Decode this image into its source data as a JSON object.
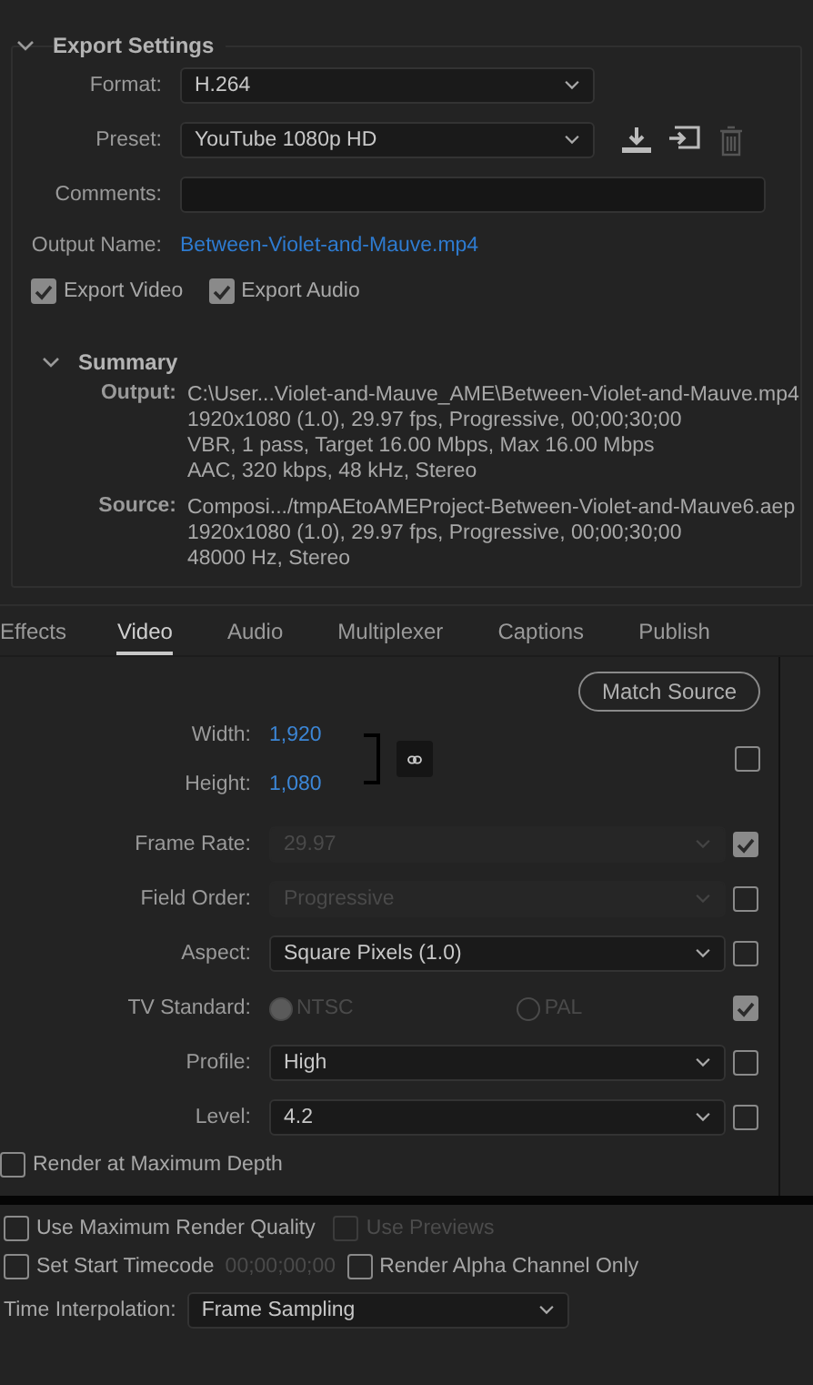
{
  "export_settings": {
    "title": "Export Settings",
    "expanded": true,
    "format": {
      "label": "Format:",
      "value": "H.264"
    },
    "preset": {
      "label": "Preset:",
      "value": "YouTube 1080p HD"
    },
    "comments": {
      "label": "Comments:"
    },
    "output_name": {
      "label": "Output Name:",
      "value": "Between-Violet-and-Mauve.mp4"
    },
    "export_video": {
      "label": "Export Video",
      "checked": true
    },
    "export_audio": {
      "label": "Export Audio",
      "checked": true
    },
    "summary": {
      "title": "Summary",
      "expanded": true,
      "output": {
        "label": "Output:",
        "lines": [
          "C:\\User...Violet-and-Mauve_AME\\Between-Violet-and-Mauve.mp4",
          "1920x1080 (1.0), 29.97 fps, Progressive, 00;00;30;00",
          "VBR, 1 pass, Target 16.00 Mbps, Max 16.00 Mbps",
          "AAC, 320 kbps, 48 kHz, Stereo"
        ]
      },
      "source": {
        "label": "Source:",
        "lines": [
          "Composi.../tmpAEtoAMEProject-Between-Violet-and-Mauve6.aep",
          "1920x1080 (1.0), 29.97 fps, Progressive, 00;00;30;00",
          "48000 Hz, Stereo"
        ]
      }
    }
  },
  "tabs": [
    {
      "label": "Effects",
      "selected": false
    },
    {
      "label": "Video",
      "selected": true
    },
    {
      "label": "Audio",
      "selected": false
    },
    {
      "label": "Multiplexer",
      "selected": false
    },
    {
      "label": "Captions",
      "selected": false
    },
    {
      "label": "Publish",
      "selected": false
    }
  ],
  "video": {
    "match_source": "Match Source",
    "width": {
      "label": "Width:",
      "value": "1,920"
    },
    "height": {
      "label": "Height:",
      "value": "1,080"
    },
    "size_checked": false,
    "rows": [
      {
        "kind": "select",
        "label": "Frame Rate:",
        "value": "29.97",
        "disabled": true,
        "checked": true
      },
      {
        "kind": "select",
        "label": "Field Order:",
        "value": "Progressive",
        "disabled": true,
        "checked": false
      },
      {
        "kind": "select",
        "label": "Aspect:",
        "value": "Square Pixels (1.0)",
        "disabled": false,
        "checked": false
      },
      {
        "kind": "radio",
        "label": "TV Standard:",
        "options": [
          {
            "label": "NTSC",
            "selected": true
          },
          {
            "label": "PAL",
            "selected": false
          }
        ],
        "disabled": true,
        "checked": true
      },
      {
        "kind": "select",
        "label": "Profile:",
        "value": "High",
        "disabled": false,
        "checked": false
      },
      {
        "kind": "select",
        "label": "Level:",
        "value": "4.2",
        "disabled": false,
        "checked": false
      }
    ],
    "render_max_depth": {
      "label": "Render at Maximum Depth",
      "checked": false
    }
  },
  "bottom": {
    "use_max_render_quality": {
      "label": "Use Maximum Render Quality",
      "checked": false
    },
    "use_previews": {
      "label": "Use Previews",
      "checked": false,
      "disabled": true
    },
    "set_start_timecode": {
      "label": "Set Start Timecode",
      "checked": false,
      "timecode": "00;00;00;00"
    },
    "render_alpha": {
      "label": "Render Alpha Channel Only",
      "checked": false
    },
    "time_interpolation": {
      "label": "Time Interpolation:",
      "value": "Frame Sampling"
    }
  }
}
